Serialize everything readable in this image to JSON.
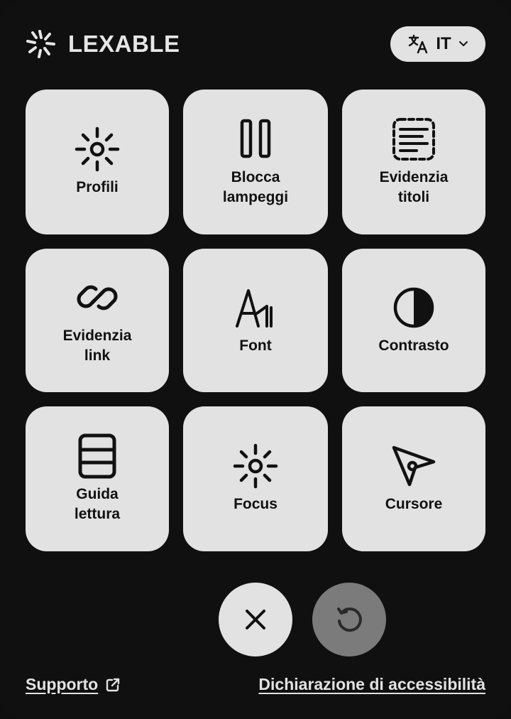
{
  "brand": {
    "name": "LEXABLE",
    "logo_icon": "lexable-burst-logo"
  },
  "language": {
    "code": "IT",
    "icon": "translate-icon",
    "chevron": "chevron-down-icon"
  },
  "tiles": [
    {
      "label": "Profili",
      "icon": "sun-icon"
    },
    {
      "label": "Blocca\nlampeggi",
      "icon": "pause-icon"
    },
    {
      "label": "Evidenzia\ntitoli",
      "icon": "highlight-titles-icon"
    },
    {
      "label": "Evidenzia\nlink",
      "icon": "link-icon"
    },
    {
      "label": "Font",
      "icon": "font-icon"
    },
    {
      "label": "Contrasto",
      "icon": "contrast-icon"
    },
    {
      "label": "Guida\nlettura",
      "icon": "reading-guide-icon"
    },
    {
      "label": "Focus",
      "icon": "focus-icon"
    },
    {
      "label": "Cursore",
      "icon": "cursor-icon"
    }
  ],
  "actions": {
    "close_icon": "close-icon",
    "reset_icon": "reset-icon"
  },
  "footer": {
    "support_label": "Supporto",
    "support_icon": "external-link-icon",
    "declaration_label": "Dichiarazione di accessibilità"
  },
  "colors": {
    "background": "#101011",
    "tile": "#e2e2e2",
    "reset_button": "#7b7b7b",
    "text_light": "#e2e2e2",
    "text_dark": "#111111"
  }
}
